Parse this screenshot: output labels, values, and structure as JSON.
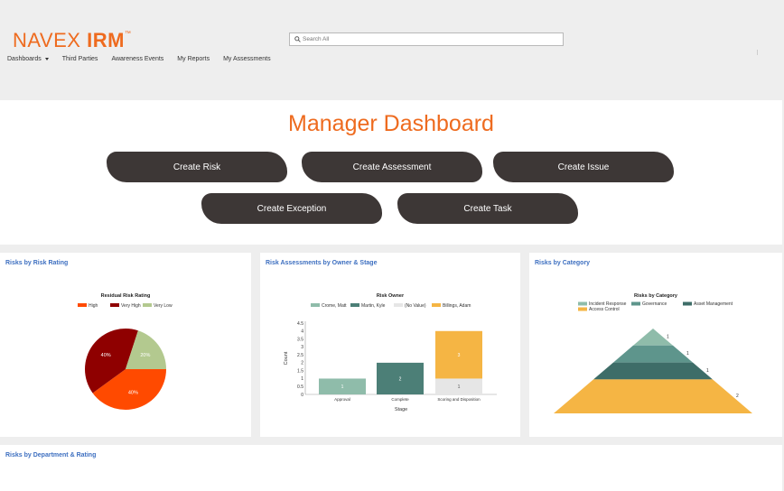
{
  "header": {
    "logo_light": "NAVEX",
    "logo_bold": "IRM",
    "logo_tm": "™",
    "search_placeholder": "Search All",
    "nav": [
      {
        "label": "Dashboards",
        "has_dropdown": true
      },
      {
        "label": "Third Parties"
      },
      {
        "label": "Awareness Events"
      },
      {
        "label": "My Reports"
      },
      {
        "label": "My Assessments"
      }
    ]
  },
  "colors": {
    "brand_orange": "#ee6b1f",
    "button_dark": "#3d3736",
    "card_link_blue": "#3d6fc0"
  },
  "main": {
    "title": "Manager Dashboard",
    "buttons": [
      "Create Risk",
      "Create Assessment",
      "Create Issue",
      "Create Exception",
      "Create Task"
    ]
  },
  "cards": {
    "rating": {
      "title": "Risks by Risk Rating"
    },
    "owner": {
      "title": "Risk Assessments by Owner & Stage"
    },
    "category": {
      "title": "Risks by Category"
    },
    "department": {
      "title": "Risks by Department & Rating"
    }
  },
  "chart_data": [
    {
      "type": "pie",
      "title": "Residual Risk Rating",
      "legend_position": "top",
      "slices": [
        {
          "label": "High",
          "percent": 40,
          "color": "#ff4a00"
        },
        {
          "label": "Very High",
          "percent": 40,
          "color": "#8f0000"
        },
        {
          "label": "Very Low",
          "percent": 20,
          "color": "#b3c98f"
        }
      ]
    },
    {
      "type": "bar",
      "stacked": true,
      "title": "Risk Owner",
      "legend_position": "top",
      "xlabel": "Stage",
      "ylabel": "Count",
      "ylim": [
        0,
        4.5
      ],
      "yticks": [
        "0",
        "0.5",
        "1",
        "1.5",
        "2",
        "2.5",
        "3",
        "3.5",
        "4",
        "4.5"
      ],
      "categories": [
        "Approval",
        "Complete",
        "Scoring and Disposition"
      ],
      "series": [
        {
          "name": "Crome, Matt",
          "color": "#8fbcaa",
          "values": [
            1,
            0,
            0
          ]
        },
        {
          "name": "Martin, Kyle",
          "color": "#4c7f77",
          "values": [
            0,
            2,
            0
          ]
        },
        {
          "name": "(No Value)",
          "color": "#e6e6e6",
          "values": [
            0,
            0,
            1
          ]
        },
        {
          "name": "Billings, Adam",
          "color": "#f5b544",
          "values": [
            0,
            0,
            3
          ]
        }
      ]
    },
    {
      "type": "pyramid",
      "title": "Risks by Category",
      "legend_position": "top",
      "tiers": [
        {
          "label": "Incident Response",
          "value": 1,
          "color": "#8fbcaa"
        },
        {
          "label": "Governance",
          "value": 1,
          "color": "#5e958c"
        },
        {
          "label": "Asset Management",
          "value": 1,
          "color": "#3e6d68"
        },
        {
          "label": "Access Control",
          "value": 2,
          "color": "#f5b544"
        }
      ]
    }
  ]
}
